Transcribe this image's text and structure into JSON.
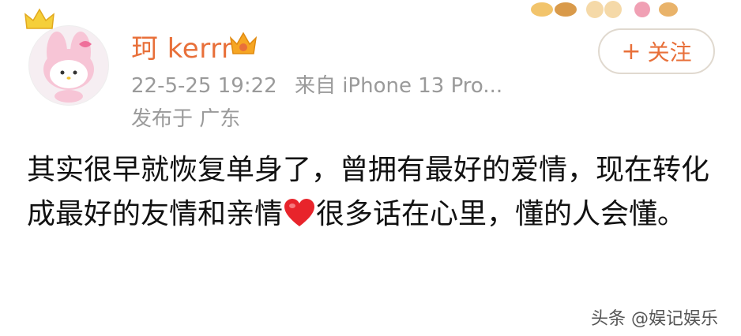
{
  "post": {
    "username": "珂 kerrr",
    "timestamp": "22-5-25 19:22",
    "source": "来自 iPhone 13 Pro...",
    "location": "发布于 广东",
    "follow_plus": "+",
    "follow_label": "关注",
    "text_part1": "其实很早就恢复单身了，曾拥有最好的爱情，现在转化成最好的友情和亲情",
    "text_part2": "很多话在心里，懂的人会懂。"
  },
  "watermark": "头条 @娱记娱乐",
  "colors": {
    "username": "#e8703a",
    "meta": "#9a9a9a",
    "follow_border": "#e0d9cf",
    "heart": "#e8242b"
  },
  "icons": [
    "avatar",
    "crown-icon",
    "vip-badge-icon",
    "heart-emoji-icon",
    "decoration-stickers"
  ]
}
